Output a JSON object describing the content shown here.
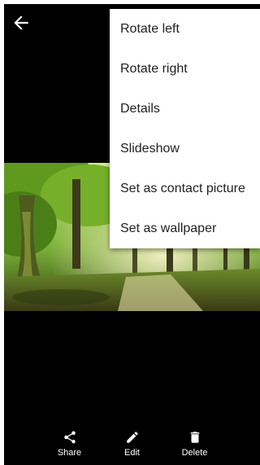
{
  "toolbar": {
    "back_icon": "arrow-back-icon"
  },
  "overflow_menu": {
    "items": [
      {
        "label": "Rotate left"
      },
      {
        "label": "Rotate right"
      },
      {
        "label": "Details"
      },
      {
        "label": "Slideshow"
      },
      {
        "label": "Set as contact picture"
      },
      {
        "label": "Set as wallpaper"
      }
    ]
  },
  "bottom_bar": {
    "share": {
      "label": "Share",
      "icon": "share-icon"
    },
    "edit": {
      "label": "Edit",
      "icon": "pencil-icon"
    },
    "delete": {
      "label": "Delete",
      "icon": "trash-icon"
    }
  },
  "colors": {
    "background": "#000000",
    "menu_background": "#ffffff",
    "menu_text": "#212121",
    "icon": "#ffffff"
  }
}
